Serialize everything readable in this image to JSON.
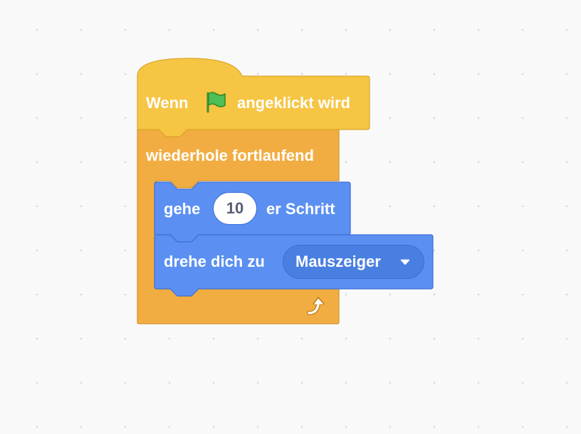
{
  "workspace": {
    "background_color": "#f9f9f9",
    "grid_dot_color": "#d7dbe0"
  },
  "script": {
    "hat_block": {
      "label_before": "Wenn",
      "icon": "green-flag-icon",
      "label_after": "angeklickt wird",
      "color": "#f6c543",
      "border_color": "#d9a62a"
    },
    "forever_block": {
      "label": "wiederhole fortlaufend",
      "icon": "repeat-arrow-icon",
      "color": "#f2ad42",
      "border_color": "#d4912b"
    },
    "move_block": {
      "label_before": "gehe",
      "steps_value": "10",
      "label_after": "er Schritt",
      "color": "#5b90f2",
      "border_color": "#3d6fd6"
    },
    "point_towards_block": {
      "label": "drehe dich zu",
      "dropdown_value": "Mauszeiger",
      "dropdown_icon": "caret-down-icon",
      "color": "#5b90f2",
      "border_color": "#3d6fd6"
    }
  }
}
